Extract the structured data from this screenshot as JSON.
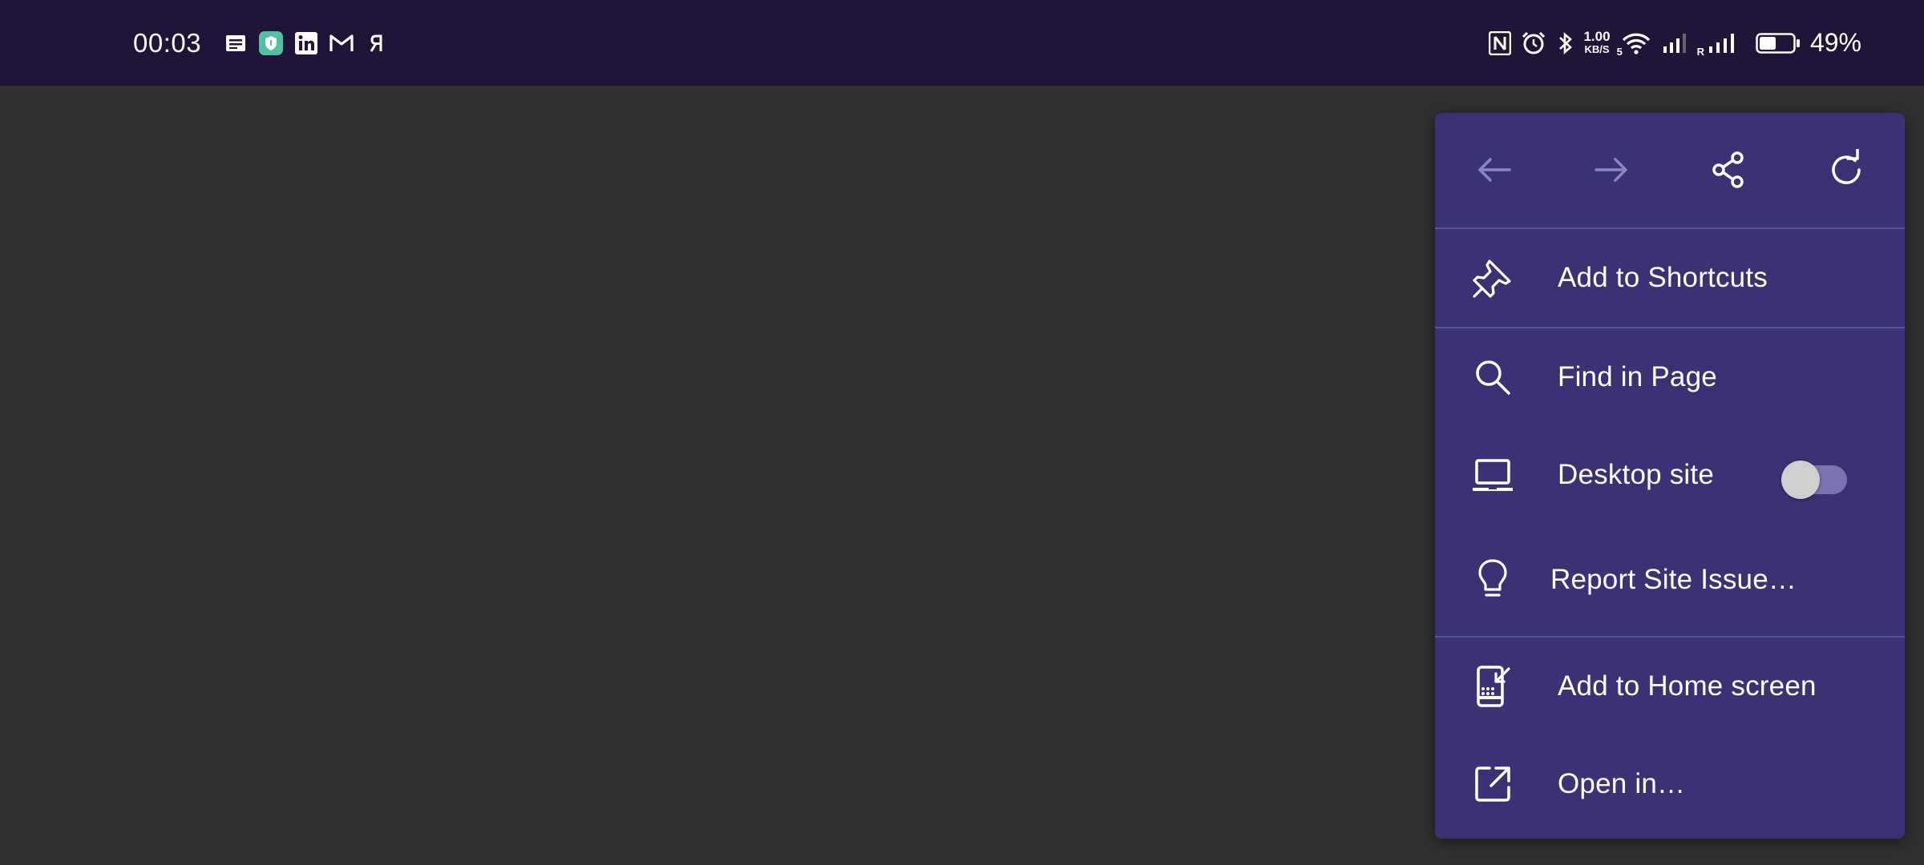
{
  "status_bar": {
    "time": "00:03",
    "notification_icons": [
      "news-icon",
      "shield-app-icon",
      "linkedin-icon",
      "gmail-icon",
      "r-app-icon"
    ],
    "net_speed_value": "1.00",
    "net_speed_unit": "KB/S",
    "wifi_band": "5",
    "sim2_label": "R",
    "battery_percent": "49%",
    "battery_level": 0.49
  },
  "menu": {
    "nav": {
      "back_icon": "arrow-left-icon",
      "forward_icon": "arrow-right-icon",
      "share_icon": "share-icon",
      "reload_icon": "reload-icon"
    },
    "items": [
      {
        "label": "Add to Shortcuts",
        "icon": "pin-icon"
      },
      {
        "label": "Find in Page",
        "icon": "search-icon"
      },
      {
        "label": "Desktop site",
        "icon": "laptop-icon",
        "toggle": false
      },
      {
        "label": "Report Site Issue…",
        "icon": "lightbulb-icon"
      },
      {
        "label": "Add to Home screen",
        "icon": "add-to-home-icon"
      },
      {
        "label": "Open in…",
        "icon": "open-external-icon"
      }
    ]
  },
  "colors": {
    "status_bar_bg": "#201538",
    "page_bg": "#303030",
    "menu_bg": "#3a3275",
    "divider": "#5a53a0",
    "disabled_icon": "#8c86c2"
  }
}
